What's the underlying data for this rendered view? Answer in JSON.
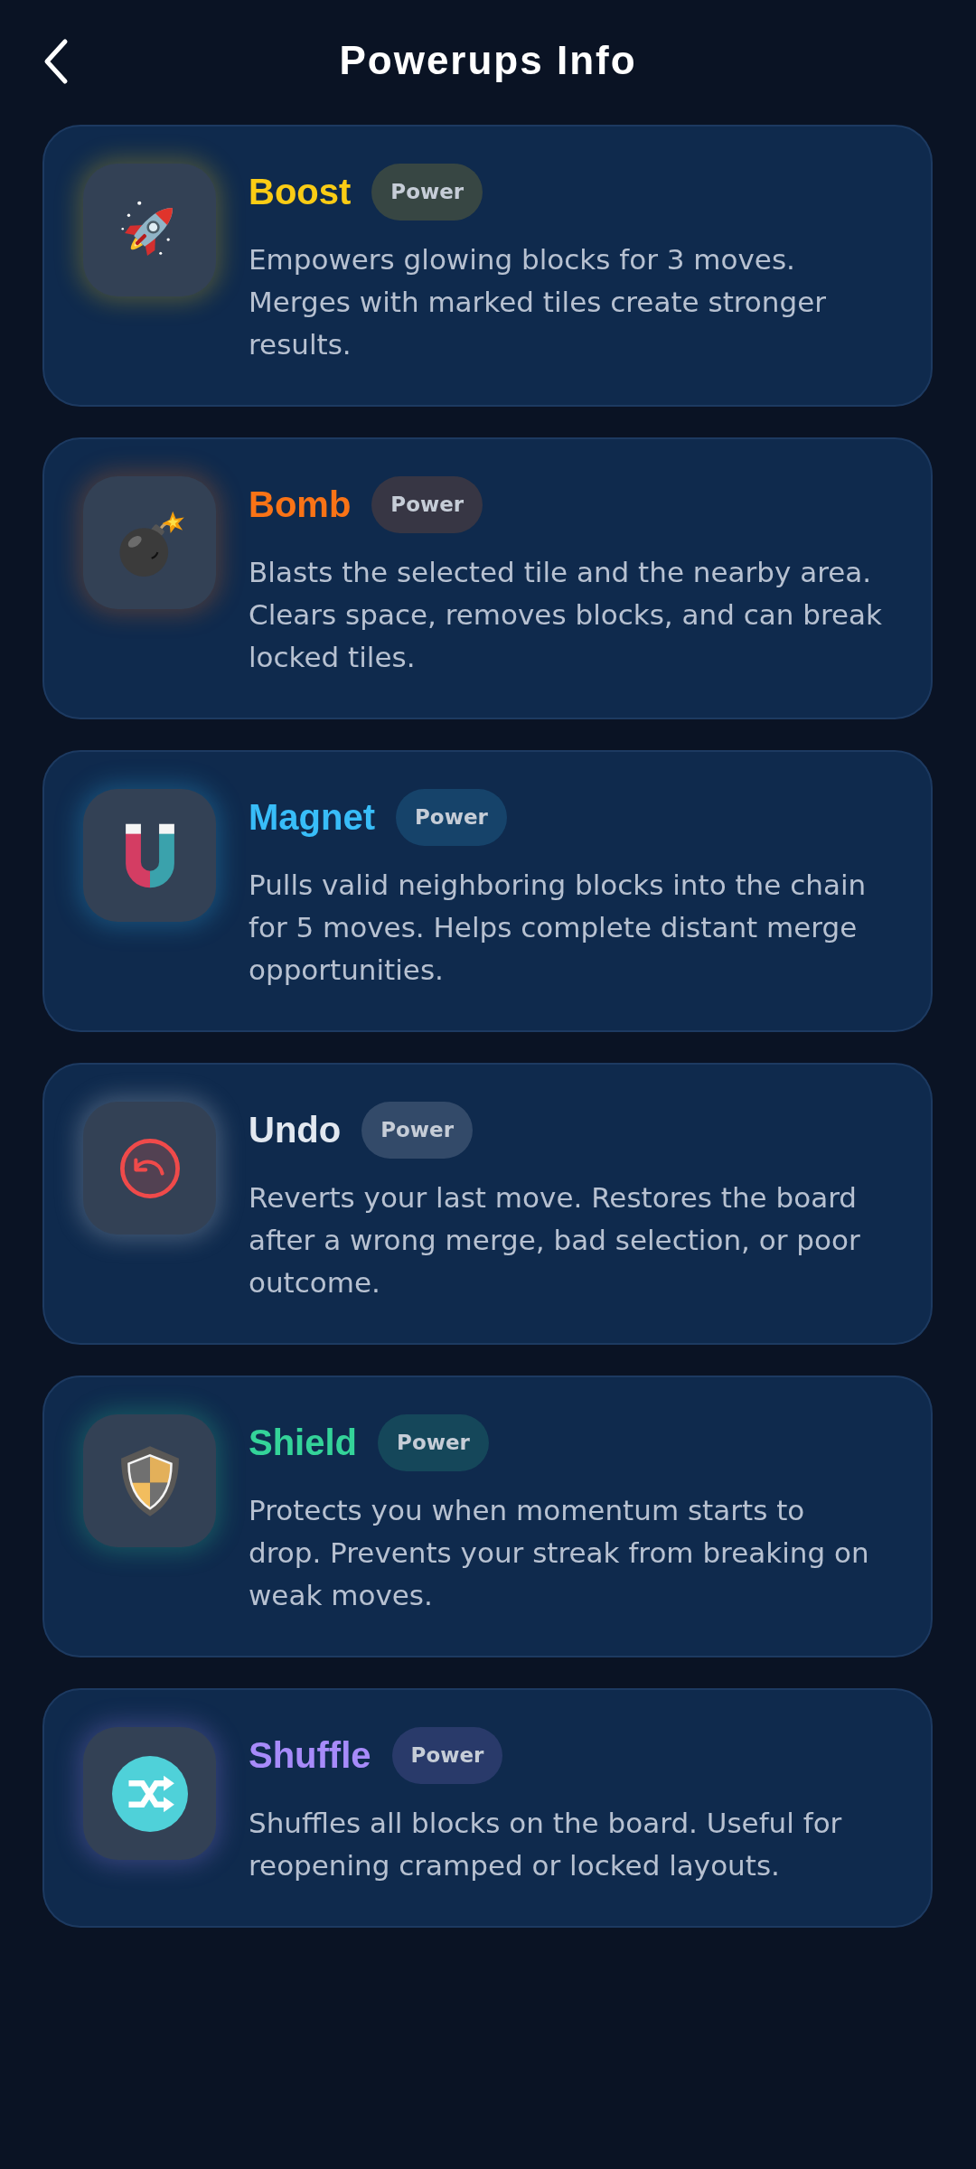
{
  "header": {
    "title": "Powerups Info"
  },
  "powerups": [
    {
      "name": "Boost",
      "badge": "Power",
      "color": "#facc15",
      "description": "Empowers glowing blocks for 3 moves. Merges with marked tiles create stronger results."
    },
    {
      "name": "Bomb",
      "badge": "Power",
      "color": "#f97316",
      "description": "Blasts the selected tile and the nearby area. Clears space, removes blocks, and can break locked tiles."
    },
    {
      "name": "Magnet",
      "badge": "Power",
      "color": "#38bdf8",
      "description": "Pulls valid neighboring blocks into the chain for 5 moves. Helps complete distant merge opportunities."
    },
    {
      "name": "Undo",
      "badge": "Power",
      "color": "#e2e8f0",
      "description": "Reverts your last move. Restores the board after a wrong merge, bad selection, or poor outcome."
    },
    {
      "name": "Shield",
      "badge": "Power",
      "color": "#34d399",
      "description": "Protects you when momentum starts to drop. Prevents your streak from breaking on weak moves."
    },
    {
      "name": "Shuffle",
      "badge": "Power",
      "color": "#a78bfa",
      "description": "Shuffles all blocks on the board. Useful for reopening cramped or locked layouts."
    }
  ]
}
